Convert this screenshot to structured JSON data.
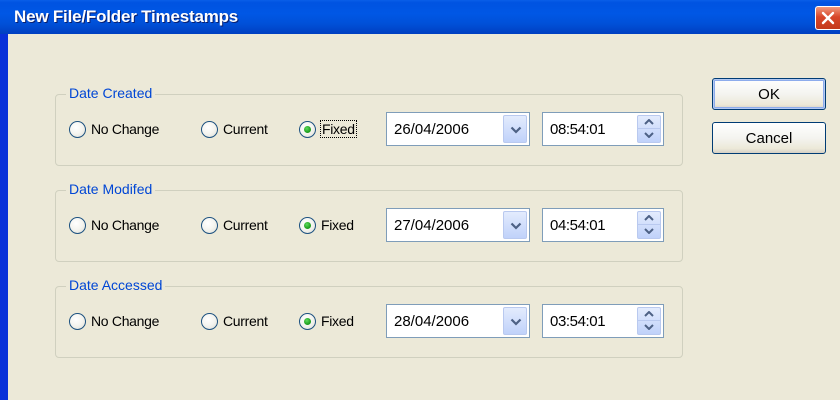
{
  "window": {
    "title": "New File/Folder Timestamps"
  },
  "groups": [
    {
      "legend": "Date Created",
      "options": [
        "No Change",
        "Current",
        "Fixed"
      ],
      "selected": "Fixed",
      "date": "26/04/2006",
      "time": "08:54:01"
    },
    {
      "legend": "Date Modifed",
      "options": [
        "No Change",
        "Current",
        "Fixed"
      ],
      "selected": "Fixed",
      "date": "27/04/2006",
      "time": "04:54:01"
    },
    {
      "legend": "Date Accessed",
      "options": [
        "No Change",
        "Current",
        "Fixed"
      ],
      "selected": "Fixed",
      "date": "28/04/2006",
      "time": "03:54:01"
    }
  ],
  "buttons": {
    "ok": "OK",
    "cancel": "Cancel"
  },
  "colors": {
    "titlebar": "#0054e3",
    "dialog_background": "#ece9d8",
    "group_legend": "#0046d5"
  }
}
